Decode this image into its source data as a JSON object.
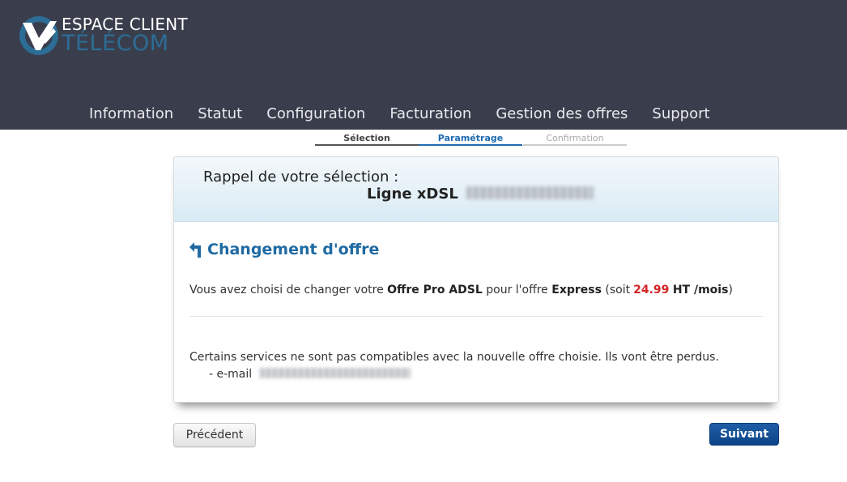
{
  "brand": {
    "line1": "ESPACE CLIENT",
    "line2": "TÉLÉCOM",
    "colors": {
      "header_bg": "#3a3e4c",
      "accent_blue": "#2c6d95"
    }
  },
  "nav": {
    "items": [
      {
        "label": "Information"
      },
      {
        "label": "Statut"
      },
      {
        "label": "Configuration"
      },
      {
        "label": "Facturation"
      },
      {
        "label": "Gestion des offres"
      },
      {
        "label": "Support"
      }
    ]
  },
  "stepper": {
    "steps": [
      {
        "label": "Sélection",
        "state": "done"
      },
      {
        "label": "Paramétrage",
        "state": "active"
      },
      {
        "label": "Confirmation",
        "state": "pending"
      }
    ],
    "colors": {
      "done": "#555555",
      "active": "#1e6bb0",
      "pending": "#cccccc"
    }
  },
  "panel": {
    "recall_title": "Rappel de votre sélection :",
    "line_label": "Ligne xDSL",
    "section_title": "Changement d'offre",
    "section_icon": "return-arrow-icon",
    "summary": {
      "prefix": "Vous avez choisi de changer votre",
      "current_offer": "Offre Pro ADSL",
      "middle": "pour l'offre",
      "new_offer": "Express",
      "price_open": "(soit",
      "price": "24.99",
      "price_unit": "HT /mois",
      "price_close": ")"
    },
    "warning": "Certains services ne sont pas compatibles avec la nouvelle offre choisie. Ils vont être perdus.",
    "lost_item_label": "- e-mail"
  },
  "actions": {
    "previous_label": "Précédent",
    "next_label": "Suivant"
  }
}
